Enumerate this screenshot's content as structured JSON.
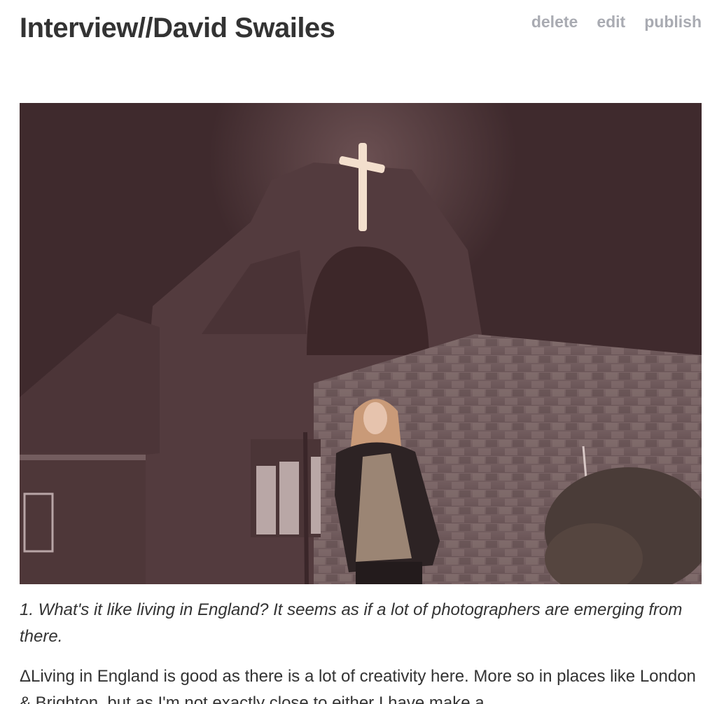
{
  "post": {
    "title": "Interview//David Swailes",
    "actions": {
      "delete": "delete",
      "edit": "edit",
      "publish": "publish"
    },
    "photo": {
      "colors": {
        "sky": "#3f2a2d",
        "building": "#5a4143",
        "cross": "#f3dfcd"
      }
    },
    "question": "1. What's it like living in England? It seems as if a lot of photographers are emerging from there.",
    "answer": "ΔLiving in England is good as there is a lot of creativity here. More so in places like London & Brighton, but as I'm not exactly close to either I have make a"
  },
  "colors": {
    "text": "#333333",
    "action_link": "#a9abb2",
    "background": "#ffffff"
  }
}
